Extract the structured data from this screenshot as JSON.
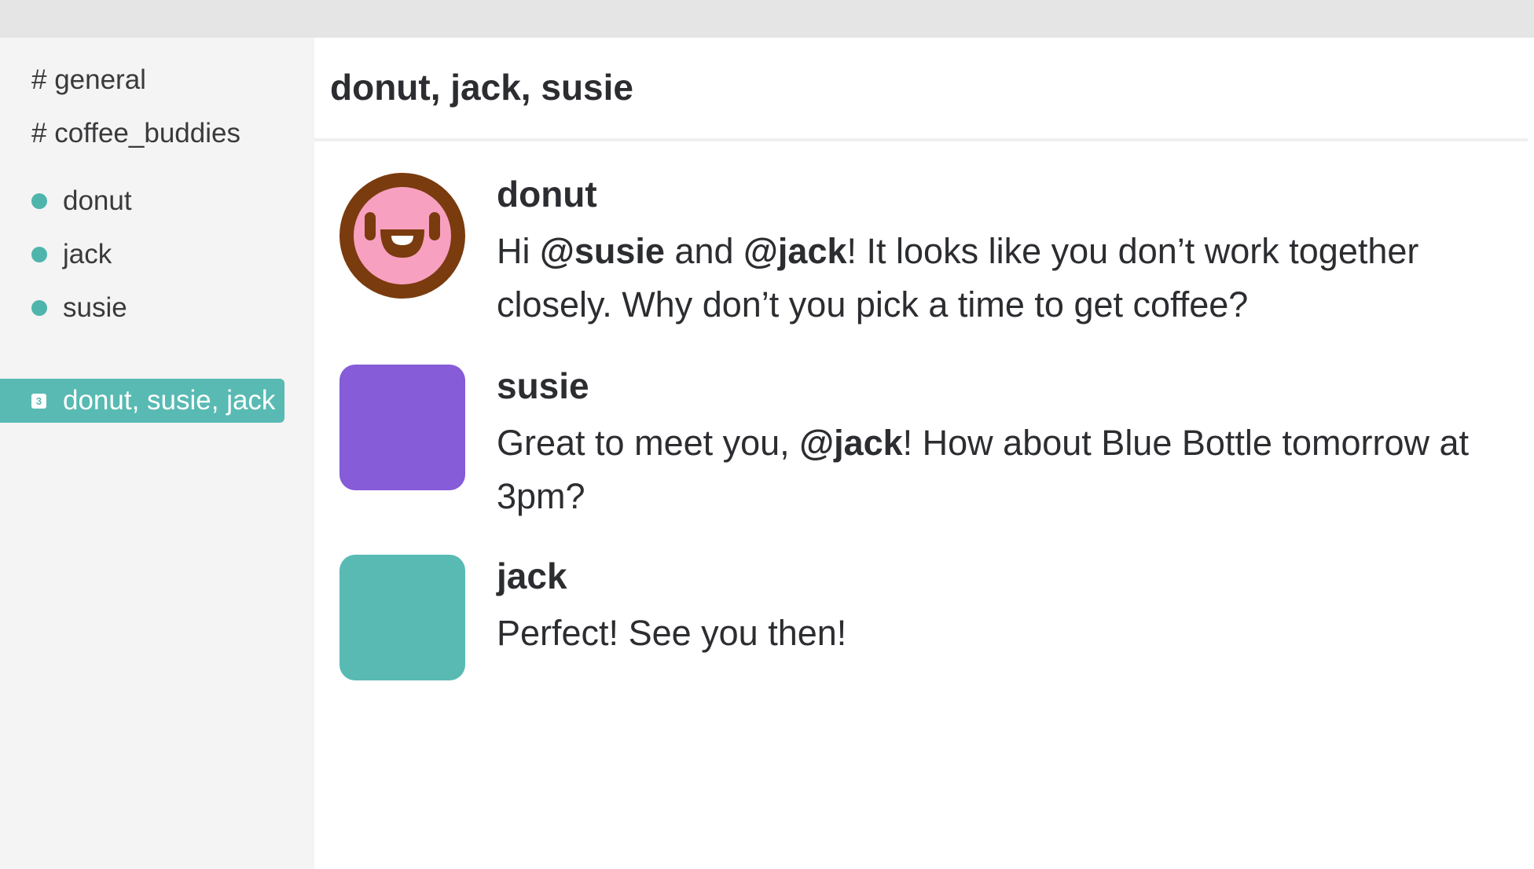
{
  "sidebar": {
    "channels": [
      "# general",
      "# coffee_buddies"
    ],
    "direct_messages": [
      "donut",
      "jack",
      "susie"
    ],
    "group_dm": {
      "count": "3",
      "label": "donut, susie, jack"
    }
  },
  "conversation": {
    "title": "donut, jack, susie",
    "messages": [
      {
        "author": "donut",
        "avatar": "donut-face-icon",
        "parts": [
          "Hi ",
          "@susie",
          " and ",
          "@jack",
          "! It looks like you don’t work together closely. Why don’t you pick a time to get coffee?"
        ]
      },
      {
        "author": "susie",
        "avatar_color": "#865cd8",
        "parts": [
          "Great to meet you, ",
          "@jack",
          "! How about Blue Bottle tomorrow at 3pm?"
        ]
      },
      {
        "author": "jack",
        "avatar_color": "#58bab3",
        "parts": [
          "Perfect! See you then!"
        ]
      }
    ]
  },
  "colors": {
    "accent": "#58bab3",
    "presence": "#4fb5ac",
    "donut_ring": "#7a3b0e",
    "donut_icing": "#f7a0c0",
    "susie_avatar": "#865cd8",
    "jack_avatar": "#58bab3"
  }
}
